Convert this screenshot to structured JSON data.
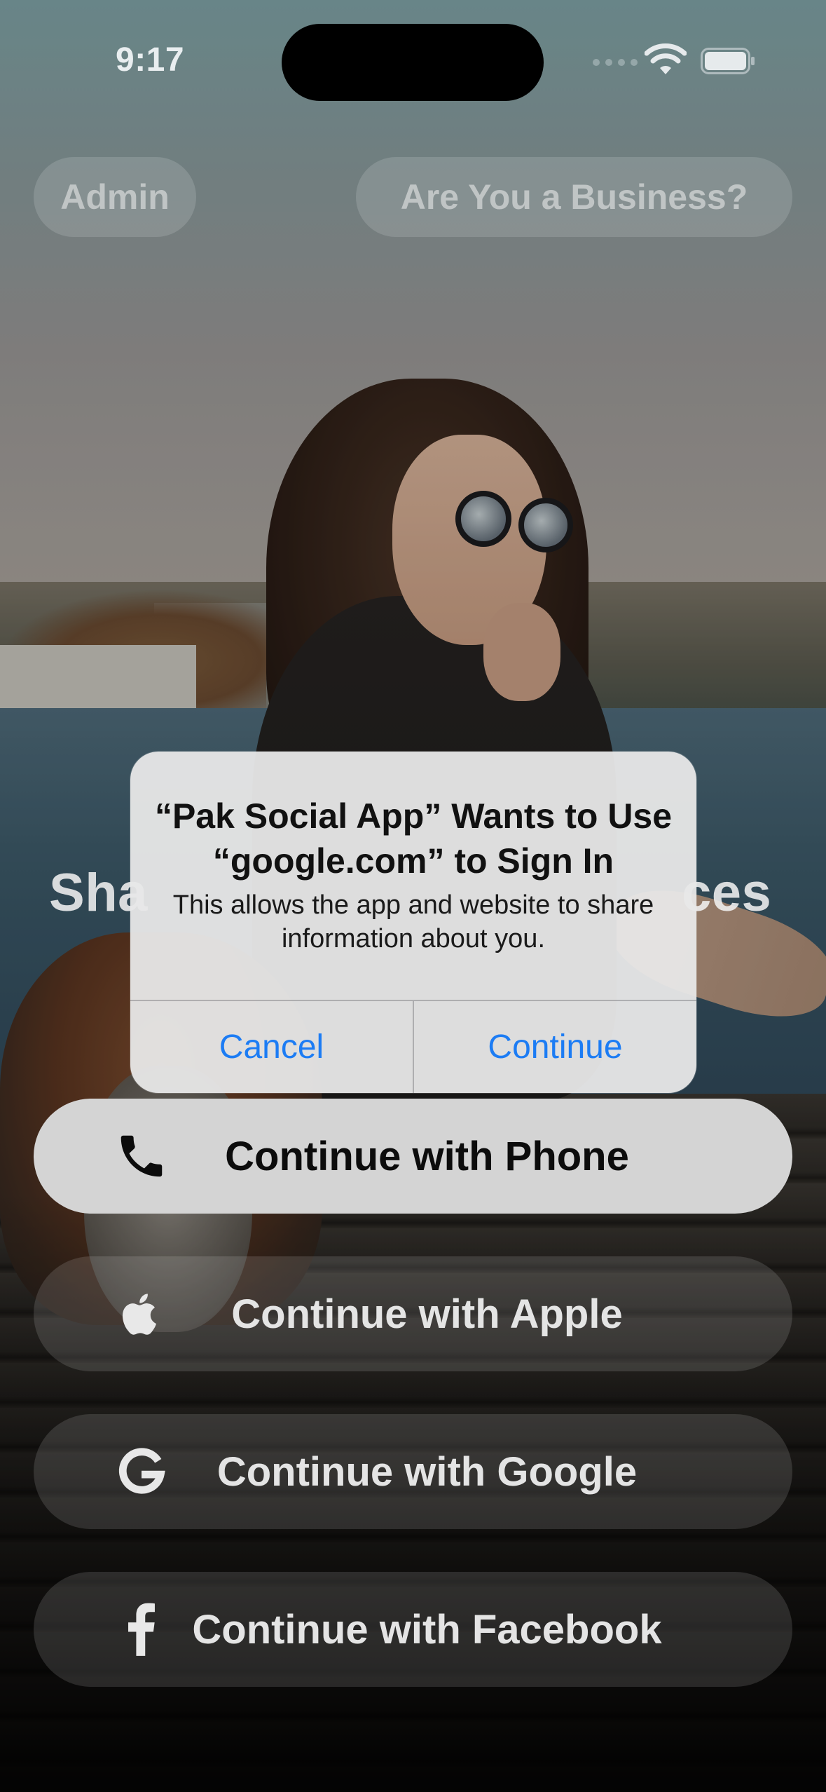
{
  "status_bar": {
    "time": "9:17"
  },
  "top_bar": {
    "admin_label": "Admin",
    "business_label": "Are You a Business?"
  },
  "headline": {
    "left_fragment": "Sha",
    "right_fragment": "ces"
  },
  "alert": {
    "title": "“Pak Social App” Wants to Use “google.com” to Sign In",
    "message": "This allows the app and website to share information about you.",
    "cancel_label": "Cancel",
    "continue_label": "Continue",
    "button_color": "#1c7cf4"
  },
  "auth_buttons": {
    "phone": {
      "label": "Continue with Phone",
      "icon": "phone-icon"
    },
    "apple": {
      "label": "Continue with Apple",
      "icon": "apple-icon"
    },
    "google": {
      "label": "Continue with Google",
      "icon": "google-icon"
    },
    "facebook": {
      "label": "Continue with Facebook",
      "icon": "facebook-icon"
    }
  }
}
